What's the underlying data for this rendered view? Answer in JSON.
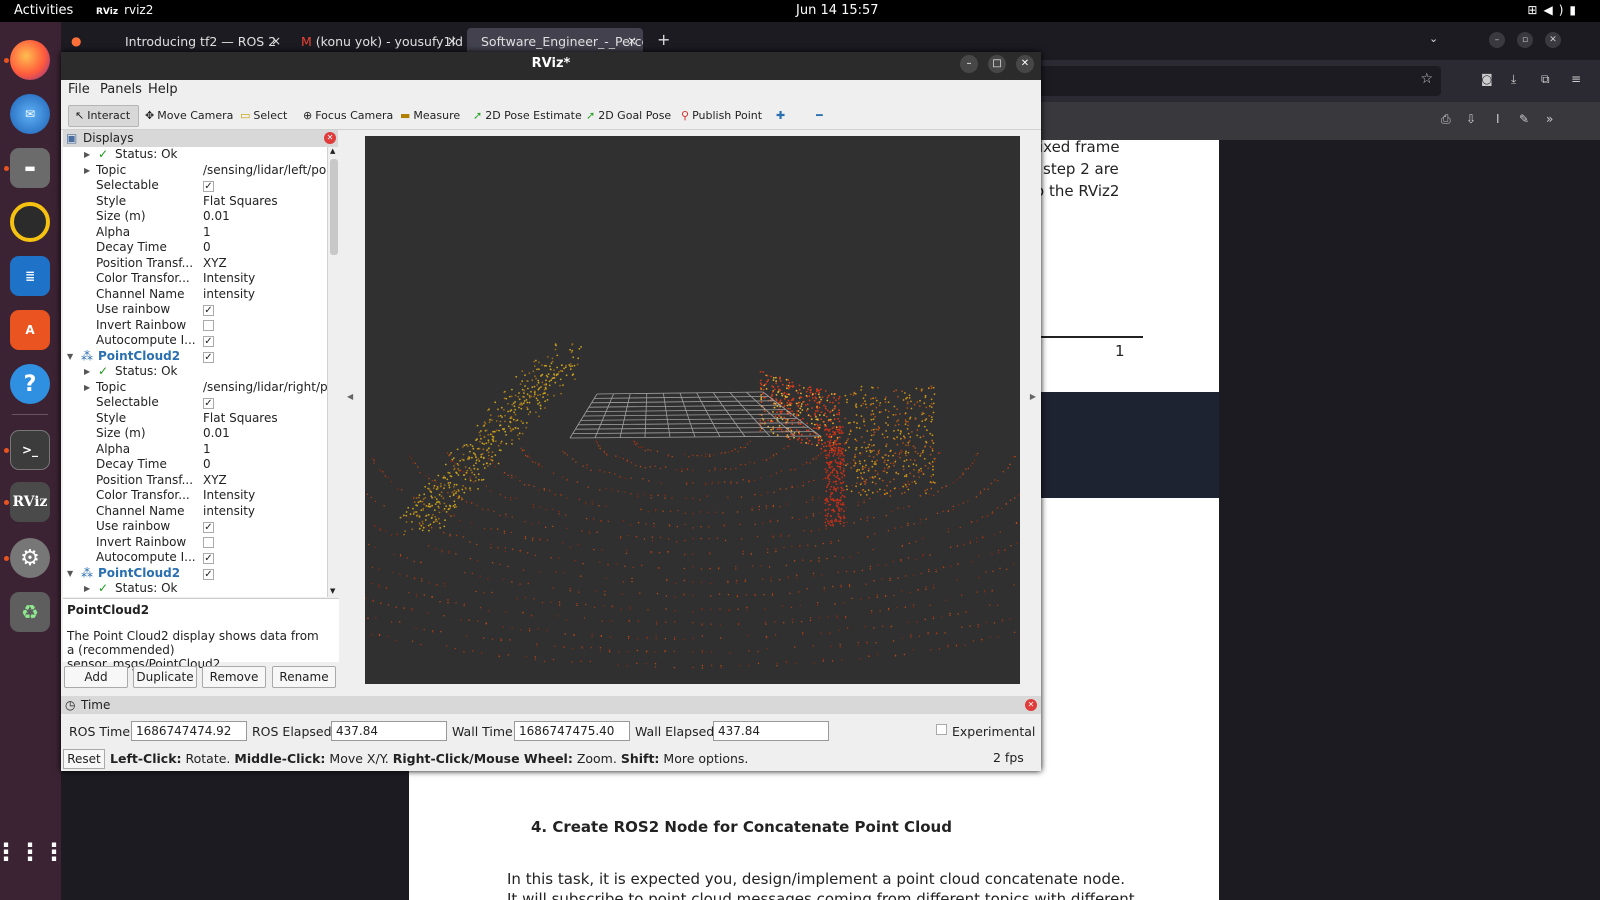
{
  "topbar": {
    "activities": "Activities",
    "app_name": "rviz2",
    "app_logo": "RViz",
    "clock": "Jun 14  15:57"
  },
  "dock": {
    "icons": [
      "firefox-icon",
      "thunderbird-icon",
      "files-icon",
      "rhythmbox-icon",
      "writer-icon",
      "app-center-icon",
      "help-icon",
      "terminal-icon",
      "rviz-icon",
      "settings-icon",
      "trash-icon",
      "apps-grid-icon"
    ]
  },
  "firefox": {
    "tabs": [
      {
        "title": "Introducing tf2 — ROS 2",
        "close": "×"
      },
      {
        "title": "(konu yok) - yousufy1ld1:",
        "close": "×"
      },
      {
        "title": "Software_Engineer_-_Percep",
        "close": "×"
      }
    ],
    "new_tab": "+"
  },
  "pdf": {
    "line1": "ixed frame",
    "line2": "step 2 are",
    "line3": "o the RViz2",
    "page_number": "1",
    "heading": "4.  Create ROS2 Node for Concatenate Point Cloud",
    "para1": "In this task, it is expected you, design/implement a point cloud concatenate node.",
    "para2": "It will subscribe to point cloud messages coming from different topics with different"
  },
  "rviz": {
    "title": "RViz*",
    "menu": [
      "File",
      "Panels",
      "Help"
    ],
    "tools": [
      "Interact",
      "Move Camera",
      "Select",
      "Focus Camera",
      "Measure",
      "2D Pose Estimate",
      "2D Goal Pose",
      "Publish Point"
    ],
    "displays_title": "Displays",
    "tree": [
      {
        "key": "Status: Ok",
        "value": "",
        "type": "status"
      },
      {
        "key": "Topic",
        "value": "/sensing/lidar/left/po...",
        "type": "expand"
      },
      {
        "key": "Selectable",
        "value": "✓",
        "type": "check"
      },
      {
        "key": "Style",
        "value": "Flat Squares",
        "type": "prop"
      },
      {
        "key": "Size (m)",
        "value": "0.01",
        "type": "prop"
      },
      {
        "key": "Alpha",
        "value": "1",
        "type": "prop"
      },
      {
        "key": "Decay Time",
        "value": "0",
        "type": "prop"
      },
      {
        "key": "Position Transf...",
        "value": "XYZ",
        "type": "prop"
      },
      {
        "key": "Color Transfor...",
        "value": "Intensity",
        "type": "prop"
      },
      {
        "key": "Channel Name",
        "value": "intensity",
        "type": "prop"
      },
      {
        "key": "Use rainbow",
        "value": "✓",
        "type": "check"
      },
      {
        "key": "Invert Rainbow",
        "value": "",
        "type": "check"
      },
      {
        "key": "Autocompute I...",
        "value": "✓",
        "type": "check"
      },
      {
        "key": "PointCloud2",
        "value": "✓",
        "type": "group"
      },
      {
        "key": "Status: Ok",
        "value": "",
        "type": "status"
      },
      {
        "key": "Topic",
        "value": "/sensing/lidar/right/p...",
        "type": "expand"
      },
      {
        "key": "Selectable",
        "value": "✓",
        "type": "check"
      },
      {
        "key": "Style",
        "value": "Flat Squares",
        "type": "prop"
      },
      {
        "key": "Size (m)",
        "value": "0.01",
        "type": "prop"
      },
      {
        "key": "Alpha",
        "value": "1",
        "type": "prop"
      },
      {
        "key": "Decay Time",
        "value": "0",
        "type": "prop"
      },
      {
        "key": "Position Transf...",
        "value": "XYZ",
        "type": "prop"
      },
      {
        "key": "Color Transfor...",
        "value": "Intensity",
        "type": "prop"
      },
      {
        "key": "Channel Name",
        "value": "intensity",
        "type": "prop"
      },
      {
        "key": "Use rainbow",
        "value": "✓",
        "type": "check"
      },
      {
        "key": "Invert Rainbow",
        "value": "",
        "type": "check"
      },
      {
        "key": "Autocompute I...",
        "value": "✓",
        "type": "check"
      },
      {
        "key": "PointCloud2",
        "value": "✓",
        "type": "group"
      },
      {
        "key": "Status: Ok",
        "value": "",
        "type": "status"
      }
    ],
    "desc_title": "PointCloud2",
    "desc_text": "The Point Cloud2 display shows data from a (recommended) sensor_msgs/PointCloud2",
    "buttons": {
      "add": "Add",
      "duplicate": "Duplicate",
      "remove": "Remove",
      "rename": "Rename"
    },
    "time": {
      "title": "Time",
      "ros_time_label": "ROS Time:",
      "ros_time": "1686747474.92",
      "ros_elapsed_label": "ROS Elapsed:",
      "ros_elapsed": "437.84",
      "wall_time_label": "Wall Time:",
      "wall_time": "1686747475.40",
      "wall_elapsed_label": "Wall Elapsed:",
      "wall_elapsed": "437.84",
      "experimental": "Experimental"
    },
    "status": {
      "reset": "Reset",
      "left_click": "Left-Click:",
      "left_click_text": "Rotate.",
      "middle_click": "Middle-Click:",
      "middle_click_text": "Move X/Y.",
      "right_click": "Right-Click/Mouse Wheel:",
      "right_click_text": "Zoom.",
      "shift": "Shift:",
      "shift_text": "More options.",
      "fps": "2 fps"
    }
  },
  "colors": {
    "dock_bg": "#3b2333",
    "rviz_bg": "#303030",
    "accent": "#e95420",
    "group_blue": "#2a6fb0"
  }
}
